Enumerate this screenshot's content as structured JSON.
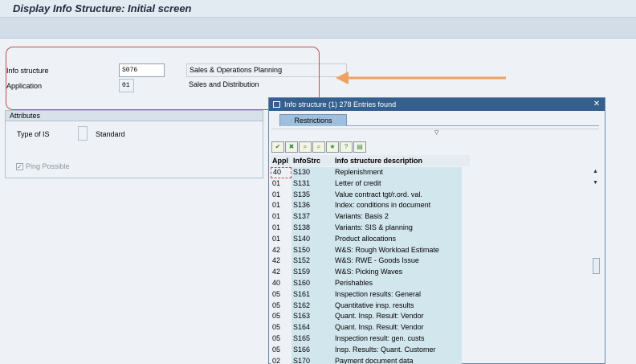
{
  "window": {
    "title": "Display Info Structure: Initial screen"
  },
  "form": {
    "info_structure_label": "Info structure",
    "info_structure_value": "S076",
    "info_structure_desc": "Sales & Operations Planning",
    "application_label": "Application",
    "application_value": "01",
    "application_desc": "Sales and Distribution"
  },
  "attributes": {
    "title": "Attributes",
    "type_label": "Type of IS",
    "type_value": "Standard",
    "ping_label": "Ping Possible",
    "ping_checked": "✓"
  },
  "popup": {
    "title": "Info structure (1)  278 Entries found",
    "tab": "Restrictions",
    "columns": [
      "Appl",
      "InfoStrc",
      "Info structure description"
    ],
    "toolbar_icons": [
      "check-icon",
      "cancel-icon",
      "find-icon",
      "find-next-icon",
      "favorites-icon",
      "help-icon",
      "print-icon"
    ],
    "rows": [
      [
        "40",
        "S130",
        "Replenishment"
      ],
      [
        "01",
        "S131",
        "Letter of credit"
      ],
      [
        "01",
        "S135",
        "Value contract tgt/r.ord. val."
      ],
      [
        "01",
        "S136",
        "Index: conditions in document"
      ],
      [
        "01",
        "S137",
        "Variants: Basis 2"
      ],
      [
        "01",
        "S138",
        "Variants: SIS & planning"
      ],
      [
        "01",
        "S140",
        "Product allocations"
      ],
      [
        "42",
        "S150",
        "W&S: Rough Workload Estimate"
      ],
      [
        "42",
        "S152",
        "W&S: RWE - Goods Issue"
      ],
      [
        "42",
        "S159",
        "W&S: Picking Waves"
      ],
      [
        "40",
        "S160",
        "Perishables"
      ],
      [
        "05",
        "S161",
        "Inspection results: General"
      ],
      [
        "05",
        "S162",
        "Quantitative insp. results"
      ],
      [
        "05",
        "S163",
        "Quant. Insp. Result: Vendor"
      ],
      [
        "05",
        "S164",
        "Quant. Insp. Result: Vendor"
      ],
      [
        "05",
        "S165",
        "Inspection result: gen. custs"
      ],
      [
        "05",
        "S166",
        "Insp. Results: Quant. Customer"
      ],
      [
        "02",
        "S170",
        "Payment document data"
      ]
    ]
  },
  "colors": {
    "callout": "#c0504d",
    "arrow": "#f0a060",
    "popup_title": "#355f8e"
  }
}
